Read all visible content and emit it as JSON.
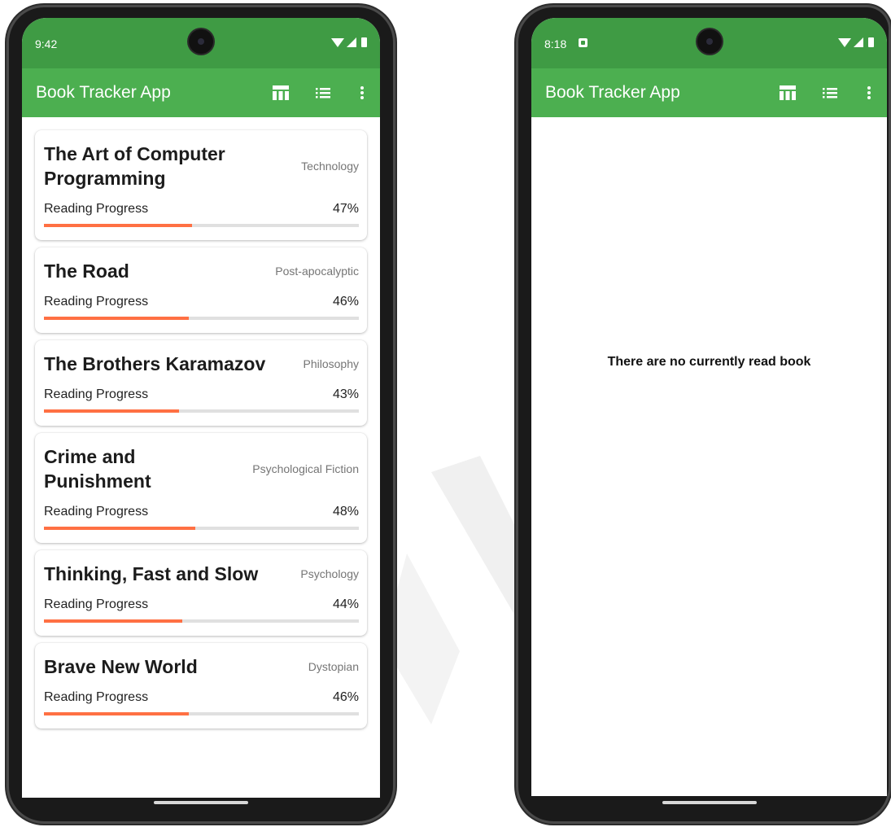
{
  "left_phone": {
    "status": {
      "time": "9:42"
    },
    "appbar": {
      "title": "Book Tracker App"
    },
    "progress_label": "Reading Progress",
    "books": [
      {
        "title": "The Art of Computer Programming",
        "genre": "Technology",
        "progress": 47,
        "progress_text": "47%"
      },
      {
        "title": "The Road",
        "genre": "Post-apocalyptic",
        "progress": 46,
        "progress_text": "46%"
      },
      {
        "title": "The Brothers Karamazov",
        "genre": "Philosophy",
        "progress": 43,
        "progress_text": "43%"
      },
      {
        "title": "Crime and Punishment",
        "genre": "Psychological Fiction",
        "progress": 48,
        "progress_text": "48%"
      },
      {
        "title": "Thinking, Fast and Slow",
        "genre": "Psychology",
        "progress": 44,
        "progress_text": "44%"
      },
      {
        "title": "Brave New World",
        "genre": "Dystopian",
        "progress": 46,
        "progress_text": "46%"
      }
    ]
  },
  "right_phone": {
    "status": {
      "time": "8:18"
    },
    "appbar": {
      "title": "Book Tracker App"
    },
    "empty_message": "There are no currently read book"
  },
  "icons": [
    "table-icon",
    "list-icon",
    "more-vert-icon",
    "wifi-icon",
    "signal-icon",
    "battery-icon"
  ],
  "colors": {
    "statusbar": "#3f9b44",
    "appbar": "#4caf50",
    "progress_fill": "#ff7043",
    "progress_track": "#e0e0e0"
  }
}
